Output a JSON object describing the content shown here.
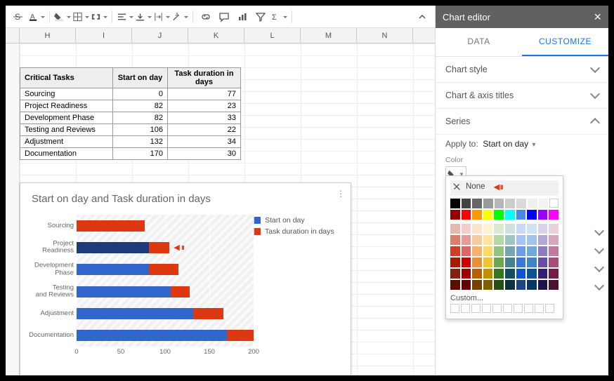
{
  "toolbar": {
    "icons": [
      "strike",
      "text-color",
      "fill-color",
      "borders",
      "merge",
      "h-align",
      "v-align",
      "wrap",
      "rotate",
      "link",
      "comment",
      "chart",
      "image",
      "filter",
      "functions"
    ]
  },
  "columns": [
    "H",
    "I",
    "J",
    "K",
    "L",
    "M",
    "N"
  ],
  "table": {
    "headers": [
      "Critical Tasks",
      "Start on day",
      "Task duration in days"
    ],
    "rows": [
      [
        "Sourcing",
        0,
        77
      ],
      [
        "Project Readiness",
        82,
        23
      ],
      [
        "Development Phase",
        82,
        33
      ],
      [
        "Testing and Reviews",
        106,
        22
      ],
      [
        "Adjustment",
        132,
        34
      ],
      [
        "Documentation",
        170,
        30
      ]
    ]
  },
  "chart_data": {
    "type": "bar",
    "title": "Start on day and Task duration in days",
    "categories": [
      "Sourcing",
      "Project Readiness",
      "Development Phase",
      "Testing and Reviews",
      "Adjustment",
      "Documentation"
    ],
    "series": [
      {
        "name": "Start on day",
        "color": "#3366cc",
        "values": [
          0,
          82,
          82,
          106,
          132,
          170
        ]
      },
      {
        "name": "Task duration in days",
        "color": "#dc3912",
        "values": [
          77,
          23,
          33,
          22,
          34,
          30
        ]
      }
    ],
    "xlim": [
      0,
      200
    ],
    "xticks": [
      0,
      50,
      100,
      150,
      200
    ],
    "highlighted_row_index": 1
  },
  "panel": {
    "title": "Chart editor",
    "tabs": {
      "data": "DATA",
      "customize": "CUSTOMIZE",
      "active": "customize"
    },
    "sections": {
      "style": "Chart style",
      "titles": "Chart & axis titles",
      "series": "Series"
    },
    "series": {
      "apply_label": "Apply to:",
      "apply_value": "Start on day",
      "color_label": "Color",
      "none_label": "None",
      "custom_label": "Custom..."
    }
  },
  "swatches": {
    "grays": [
      "#000000",
      "#434343",
      "#666666",
      "#999999",
      "#b7b7b7",
      "#cccccc",
      "#d9d9d9",
      "#efefef",
      "#f3f3f3",
      "#ffffff"
    ],
    "standard": [
      "#980000",
      "#ff0000",
      "#ff9900",
      "#ffff00",
      "#00ff00",
      "#00ffff",
      "#4a86e8",
      "#0000ff",
      "#9900ff",
      "#ff00ff"
    ],
    "tint1": [
      "#e6b8af",
      "#f4cccc",
      "#fce5cd",
      "#fff2cc",
      "#d9ead3",
      "#d0e0e3",
      "#c9daf8",
      "#cfe2f3",
      "#d9d2e9",
      "#ead1dc"
    ],
    "tint2": [
      "#dd7e6b",
      "#ea9999",
      "#f9cb9c",
      "#ffe599",
      "#b6d7a8",
      "#a2c4c9",
      "#a4c2f4",
      "#9fc5e8",
      "#b4a7d6",
      "#d5a6bd"
    ],
    "tint3": [
      "#cc4125",
      "#e06666",
      "#f6b26b",
      "#ffd966",
      "#93c47d",
      "#76a5af",
      "#6d9eeb",
      "#6fa8dc",
      "#8e7cc3",
      "#c27ba0"
    ],
    "tint4": [
      "#a61c00",
      "#cc0000",
      "#e69138",
      "#f1c232",
      "#6aa84f",
      "#45818e",
      "#3c78d8",
      "#3d85c6",
      "#674ea7",
      "#a64d79"
    ],
    "tint5": [
      "#85200c",
      "#990000",
      "#b45f06",
      "#bf9000",
      "#38761d",
      "#134f5c",
      "#1155cc",
      "#0b5394",
      "#351c75",
      "#741b47"
    ],
    "tint6": [
      "#5b0f00",
      "#660000",
      "#783f04",
      "#7f6000",
      "#274e13",
      "#0c343d",
      "#1c4587",
      "#073763",
      "#20124d",
      "#4c1130"
    ]
  }
}
